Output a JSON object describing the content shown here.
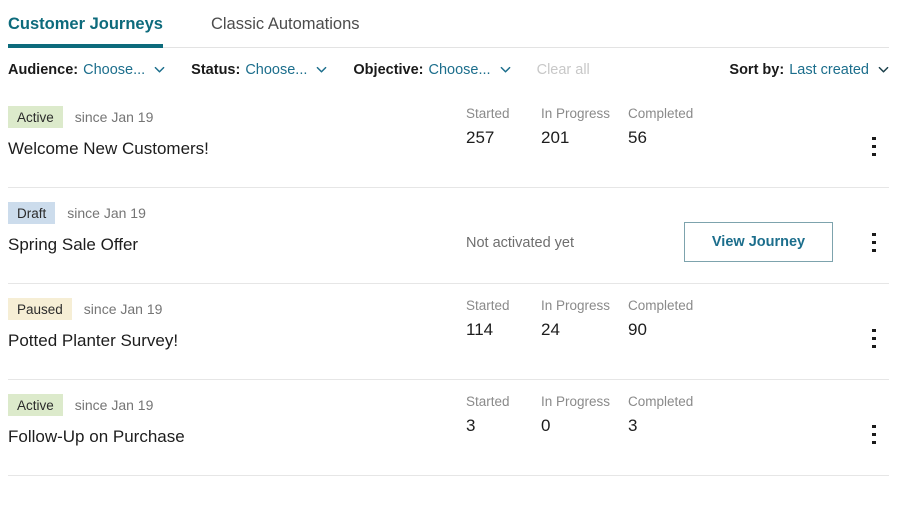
{
  "tabs": [
    {
      "label": "Customer Journeys",
      "active": true
    },
    {
      "label": "Classic Automations",
      "active": false
    }
  ],
  "filters": {
    "audience": {
      "label": "Audience:",
      "value": "Choose...",
      "icon": "chevron-down-icon"
    },
    "status": {
      "label": "Status:",
      "value": "Choose...",
      "icon": "chevron-down-icon"
    },
    "objective": {
      "label": "Objective:",
      "value": "Choose...",
      "icon": "chevron-down-icon"
    },
    "clear_all": "Clear all",
    "sort": {
      "label": "Sort by:",
      "value": "Last created",
      "icon": "chevron-down-icon"
    }
  },
  "stat_labels": {
    "started": "Started",
    "in_progress": "In Progress",
    "completed": "Completed"
  },
  "buttons": {
    "view_journey": "View Journey"
  },
  "messages": {
    "not_activated": "Not activated yet"
  },
  "journeys": [
    {
      "status": "Active",
      "status_style": "active",
      "since": "since Jan 19",
      "name": "Welcome New Customers!",
      "has_stats": true,
      "started": "257",
      "in_progress": "201",
      "completed": "56",
      "menu_icon": "kebab-menu-icon"
    },
    {
      "status": "Draft",
      "status_style": "draft",
      "since": "since Jan 19",
      "name": "Spring Sale Offer",
      "has_stats": false,
      "not_activated": "Not activated yet",
      "action": "View Journey",
      "menu_icon": "kebab-menu-icon"
    },
    {
      "status": "Paused",
      "status_style": "paused",
      "since": "since Jan 19",
      "name": "Potted Planter Survey!",
      "has_stats": true,
      "started": "114",
      "in_progress": "24",
      "completed": "90",
      "menu_icon": "kebab-menu-icon"
    },
    {
      "status": "Active",
      "status_style": "active",
      "since": "since Jan 19",
      "name": "Follow-Up on Purchase",
      "has_stats": true,
      "started": "3",
      "in_progress": "0",
      "completed": "3",
      "menu_icon": "kebab-menu-icon"
    }
  ],
  "colors": {
    "accent_teal": "#0d6b7c",
    "link_blue": "#1c6e8c",
    "badge_active_bg": "#dceacb",
    "badge_draft_bg": "#ccdcec",
    "badge_paused_bg": "#f6eed5",
    "divider": "#e6e6e6",
    "muted_text": "#8a8a8a"
  }
}
